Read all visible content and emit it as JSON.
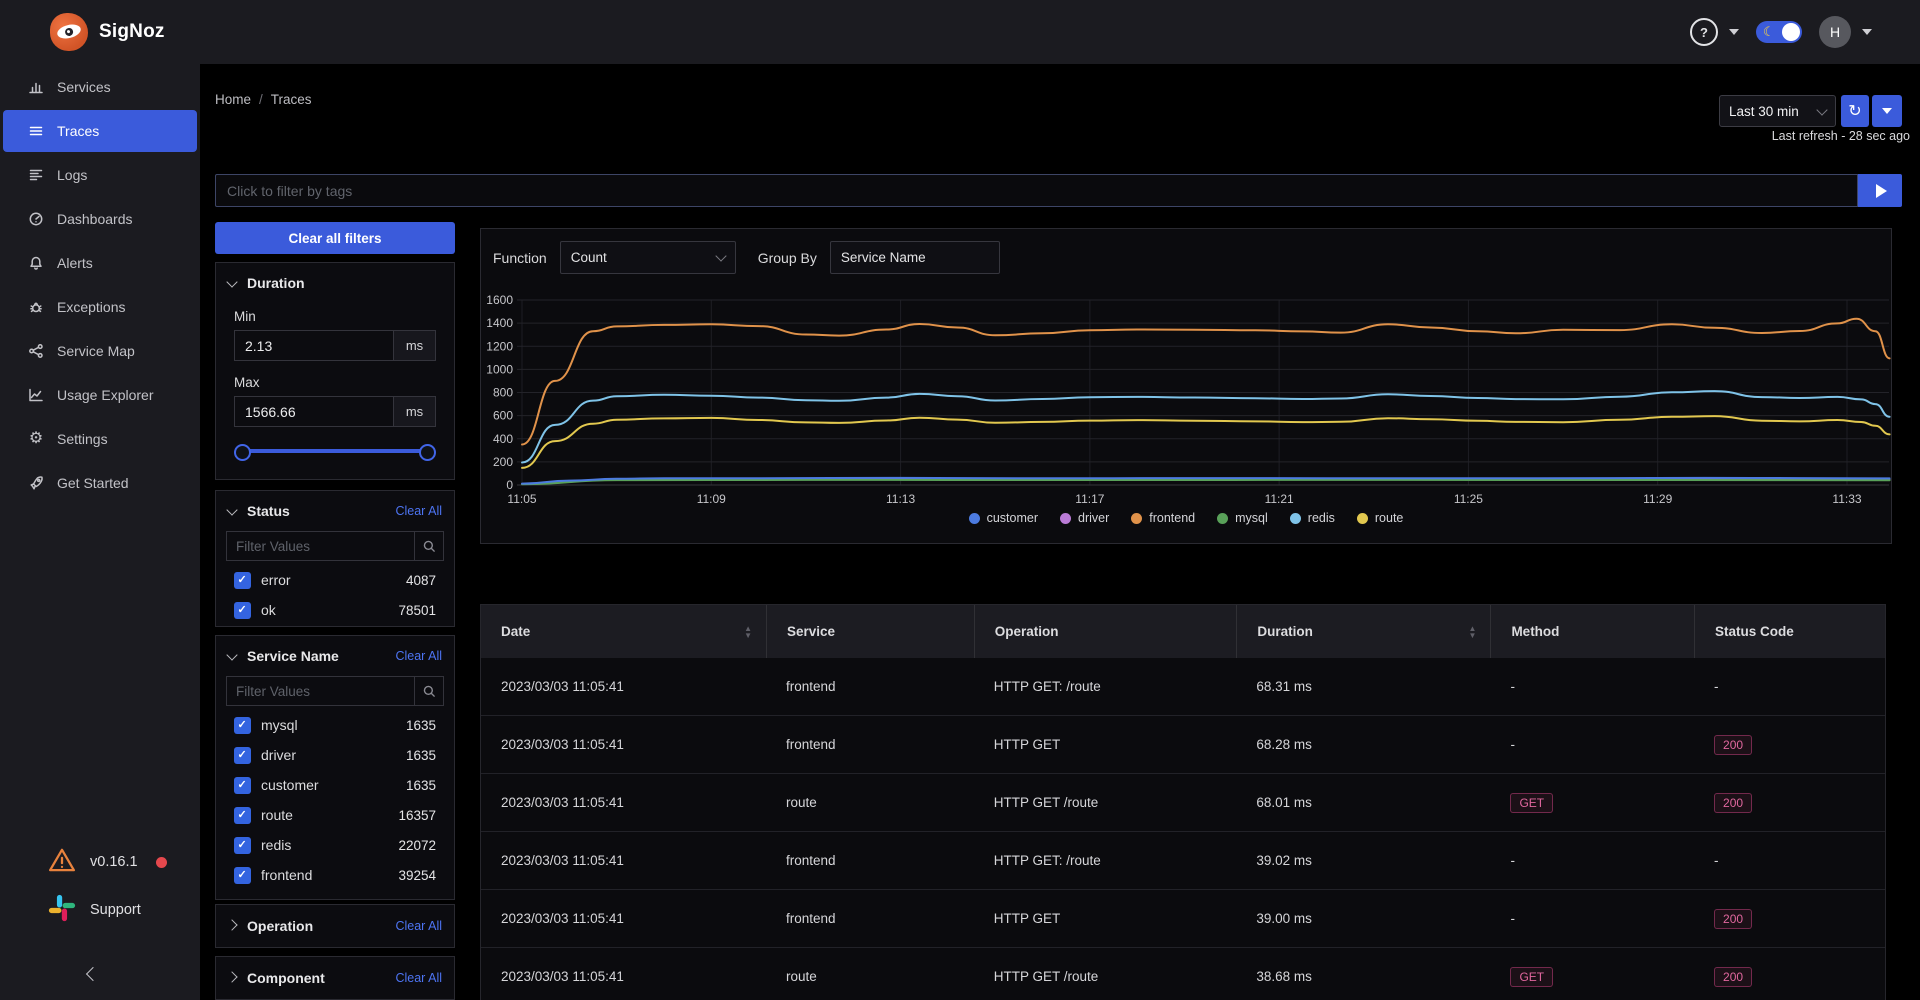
{
  "app": {
    "name": "SigNoz"
  },
  "topbar": {
    "help_label": "?",
    "avatar_initial": "H"
  },
  "sidebar": {
    "items": [
      {
        "label": "Services"
      },
      {
        "label": "Traces"
      },
      {
        "label": "Logs"
      },
      {
        "label": "Dashboards"
      },
      {
        "label": "Alerts"
      },
      {
        "label": "Exceptions"
      },
      {
        "label": "Service Map"
      },
      {
        "label": "Usage Explorer"
      },
      {
        "label": "Settings"
      },
      {
        "label": "Get Started"
      }
    ],
    "active_item": "Traces",
    "version": "v0.16.1",
    "support_label": "Support"
  },
  "breadcrumb": {
    "home": "Home",
    "separator": "/",
    "current": "Traces"
  },
  "time_controls": {
    "range_label": "Last 30 min",
    "refresh_icon": "↻",
    "last_refresh_text": "Last refresh - 28 sec ago"
  },
  "filter_bar": {
    "placeholder": "Click to filter by tags"
  },
  "filters_panel": {
    "clear_all_button": "Clear all filters",
    "clear_section_label": "Clear All",
    "filter_values_placeholder": "Filter Values",
    "duration": {
      "title": "Duration",
      "min_label": "Min",
      "min_value": "2.13",
      "max_label": "Max",
      "max_value": "1566.66",
      "unit": "ms"
    },
    "status": {
      "title": "Status",
      "items": [
        {
          "label": "error",
          "count": "4087",
          "checked": true
        },
        {
          "label": "ok",
          "count": "78501",
          "checked": true
        }
      ]
    },
    "service_name": {
      "title": "Service Name",
      "items": [
        {
          "label": "mysql",
          "count": "1635",
          "checked": true
        },
        {
          "label": "driver",
          "count": "1635",
          "checked": true
        },
        {
          "label": "customer",
          "count": "1635",
          "checked": true
        },
        {
          "label": "route",
          "count": "16357",
          "checked": true
        },
        {
          "label": "redis",
          "count": "22072",
          "checked": true
        },
        {
          "label": "frontend",
          "count": "39254",
          "checked": true
        }
      ]
    },
    "operation": {
      "title": "Operation"
    },
    "component": {
      "title": "Component"
    }
  },
  "chart_panel": {
    "function_label": "Function",
    "function_value": "Count",
    "group_by_label": "Group By",
    "group_by_value": "Service Name"
  },
  "chart_data": {
    "type": "line",
    "title": "",
    "xlabel": "",
    "ylabel": "",
    "ylim": [
      0,
      1600
    ],
    "y_ticks": [
      0,
      200,
      400,
      600,
      800,
      1000,
      1200,
      1400,
      1600
    ],
    "x_ticks": [
      "11:05",
      "11:09",
      "11:13",
      "11:17",
      "11:21",
      "11:25",
      "11:29",
      "11:33"
    ],
    "x_tick_minutes": [
      0,
      4,
      8,
      12,
      16,
      20,
      24,
      28
    ],
    "x_range_minutes": [
      0,
      28.9
    ],
    "grid": true,
    "legend_position": "bottom",
    "legend": [
      {
        "label": "customer",
        "color": "#4C7BE0"
      },
      {
        "label": "driver",
        "color": "#BA7BD6"
      },
      {
        "label": "frontend",
        "color": "#E0924A"
      },
      {
        "label": "mysql",
        "color": "#59A159"
      },
      {
        "label": "redis",
        "color": "#7FC3E8"
      },
      {
        "label": "route",
        "color": "#E2C84F"
      }
    ],
    "series": [
      {
        "name": "driver",
        "color": "#BA7BD6",
        "points": [
          [
            0,
            9
          ],
          [
            2,
            47
          ],
          [
            5,
            49
          ],
          [
            10,
            48
          ],
          [
            15,
            49
          ],
          [
            20,
            48
          ],
          [
            25,
            49
          ],
          [
            28.9,
            46
          ]
        ]
      },
      {
        "name": "mysql",
        "color": "#59A159",
        "points": [
          [
            0,
            7
          ],
          [
            2,
            42
          ],
          [
            6,
            44
          ],
          [
            12,
            43
          ],
          [
            18,
            44
          ],
          [
            24,
            43
          ],
          [
            28.9,
            41
          ]
        ]
      },
      {
        "name": "customer",
        "color": "#4C7BE0",
        "points": [
          [
            0,
            12
          ],
          [
            1,
            38
          ],
          [
            2,
            54
          ],
          [
            3,
            58
          ],
          [
            5,
            59
          ],
          [
            8,
            61
          ],
          [
            11,
            58
          ],
          [
            14,
            60
          ],
          [
            17,
            59
          ],
          [
            20,
            58
          ],
          [
            23,
            60
          ],
          [
            25,
            61
          ],
          [
            27,
            60
          ],
          [
            28.9,
            57
          ]
        ]
      },
      {
        "name": "route",
        "color": "#E2C84F",
        "points": [
          [
            0,
            148
          ],
          [
            0.7,
            380
          ],
          [
            1.5,
            530
          ],
          [
            2,
            565
          ],
          [
            3,
            576
          ],
          [
            4,
            580
          ],
          [
            5,
            562
          ],
          [
            6,
            541
          ],
          [
            6.7,
            537
          ],
          [
            7.7,
            558
          ],
          [
            8.4,
            582
          ],
          [
            9.2,
            566
          ],
          [
            10,
            538
          ],
          [
            11,
            546
          ],
          [
            12,
            557
          ],
          [
            13,
            561
          ],
          [
            14.2,
            556
          ],
          [
            15.5,
            550
          ],
          [
            16.5,
            544
          ],
          [
            17.3,
            547
          ],
          [
            18.3,
            578
          ],
          [
            19.2,
            568
          ],
          [
            20.2,
            555
          ],
          [
            21,
            546
          ],
          [
            22,
            543
          ],
          [
            23.2,
            564
          ],
          [
            24.3,
            590
          ],
          [
            25.2,
            596
          ],
          [
            26.2,
            556
          ],
          [
            27,
            550
          ],
          [
            27.8,
            562
          ],
          [
            28.3,
            545
          ],
          [
            28.6,
            512
          ],
          [
            28.9,
            438
          ]
        ]
      },
      {
        "name": "redis",
        "color": "#7FC3E8",
        "points": [
          [
            0,
            195
          ],
          [
            0.7,
            520
          ],
          [
            1.5,
            730
          ],
          [
            2,
            768
          ],
          [
            3,
            780
          ],
          [
            4,
            772
          ],
          [
            5,
            756
          ],
          [
            6,
            733
          ],
          [
            6.7,
            728
          ],
          [
            7.7,
            756
          ],
          [
            8.4,
            788
          ],
          [
            9.2,
            768
          ],
          [
            10,
            731
          ],
          [
            11,
            744
          ],
          [
            12,
            759
          ],
          [
            13,
            762
          ],
          [
            14.2,
            757
          ],
          [
            15.5,
            750
          ],
          [
            16.5,
            744
          ],
          [
            17.3,
            748
          ],
          [
            18.3,
            784
          ],
          [
            19.2,
            770
          ],
          [
            20.2,
            752
          ],
          [
            21,
            743
          ],
          [
            22,
            741
          ],
          [
            23.2,
            764
          ],
          [
            24.3,
            802
          ],
          [
            25.2,
            812
          ],
          [
            26.2,
            760
          ],
          [
            27,
            752
          ],
          [
            27.8,
            762
          ],
          [
            28.3,
            740
          ],
          [
            28.6,
            700
          ],
          [
            28.9,
            590
          ]
        ]
      },
      {
        "name": "frontend",
        "color": "#E0924A",
        "points": [
          [
            0,
            350
          ],
          [
            0.7,
            900
          ],
          [
            1.5,
            1330
          ],
          [
            2,
            1372
          ],
          [
            3,
            1385
          ],
          [
            4,
            1390
          ],
          [
            5,
            1374
          ],
          [
            6,
            1302
          ],
          [
            6.7,
            1292
          ],
          [
            7.7,
            1345
          ],
          [
            8.4,
            1392
          ],
          [
            9.2,
            1362
          ],
          [
            10,
            1295
          ],
          [
            11,
            1312
          ],
          [
            12,
            1338
          ],
          [
            13,
            1345
          ],
          [
            14.2,
            1342
          ],
          [
            15.5,
            1338
          ],
          [
            16.5,
            1328
          ],
          [
            17.3,
            1318
          ],
          [
            18.3,
            1390
          ],
          [
            19.2,
            1362
          ],
          [
            20.2,
            1330
          ],
          [
            21,
            1312
          ],
          [
            22,
            1342
          ],
          [
            23.2,
            1340
          ],
          [
            24.3,
            1390
          ],
          [
            25.2,
            1360
          ],
          [
            26.2,
            1315
          ],
          [
            27,
            1332
          ],
          [
            27.8,
            1398
          ],
          [
            28.2,
            1438
          ],
          [
            28.6,
            1330
          ],
          [
            28.9,
            1095
          ]
        ]
      }
    ]
  },
  "table": {
    "columns": [
      {
        "label": "Date",
        "sortable": true
      },
      {
        "label": "Service",
        "sortable": false
      },
      {
        "label": "Operation",
        "sortable": false
      },
      {
        "label": "Duration",
        "sortable": true
      },
      {
        "label": "Method",
        "sortable": false
      },
      {
        "label": "Status Code",
        "sortable": false
      }
    ],
    "rows": [
      {
        "date": "2023/03/03 11:05:41",
        "service": "frontend",
        "operation": "HTTP GET: /route",
        "duration": "68.31 ms",
        "method": "-",
        "status_code": "-"
      },
      {
        "date": "2023/03/03 11:05:41",
        "service": "frontend",
        "operation": "HTTP GET",
        "duration": "68.28 ms",
        "method": "-",
        "status_code": "200"
      },
      {
        "date": "2023/03/03 11:05:41",
        "service": "route",
        "operation": "HTTP GET /route",
        "duration": "68.01 ms",
        "method": "GET",
        "status_code": "200"
      },
      {
        "date": "2023/03/03 11:05:41",
        "service": "frontend",
        "operation": "HTTP GET: /route",
        "duration": "39.02 ms",
        "method": "-",
        "status_code": "-"
      },
      {
        "date": "2023/03/03 11:05:41",
        "service": "frontend",
        "operation": "HTTP GET",
        "duration": "39.00 ms",
        "method": "-",
        "status_code": "200"
      },
      {
        "date": "2023/03/03 11:05:41",
        "service": "route",
        "operation": "HTTP GET /route",
        "duration": "38.68 ms",
        "method": "GET",
        "status_code": "200"
      }
    ]
  }
}
